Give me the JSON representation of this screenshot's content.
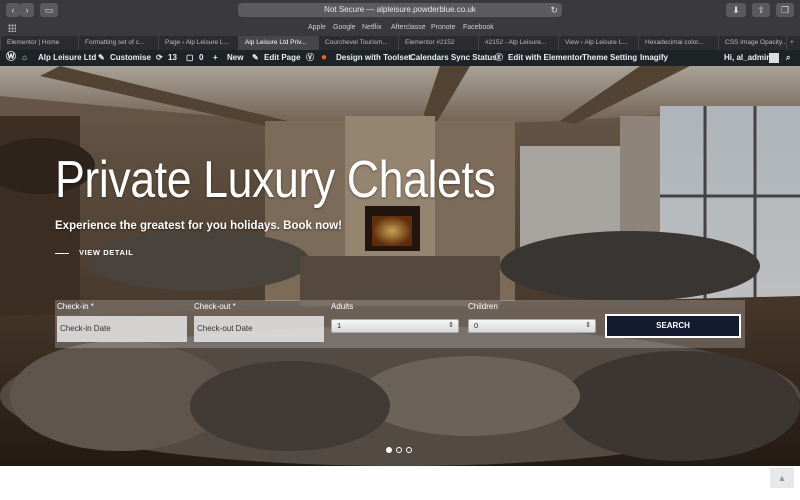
{
  "browser": {
    "url_text": "Not Secure — alpleisure.powderblue.co.uk",
    "favorites": [
      "Apple",
      "Google",
      "Netflix",
      "Afterclasse",
      "Pronote",
      "Facebook"
    ],
    "tabs": [
      "Elementor | Home",
      "Formatting set of c...",
      "Page ‹ Alp Leisure L...",
      "Alp Leisure Ltd Priv...",
      "Courchevel Tourism...",
      "Elementor #2152",
      "#2152 - Alp Leisure...",
      "View ‹ Alp Leisure L...",
      "Hexadecimal color...",
      "CSS Image Opacity..."
    ],
    "active_tab_index": 3,
    "new_tab": "+"
  },
  "wpbar": {
    "site_name": "Alp Leisure Ltd",
    "customise": "Customise",
    "updates": "13",
    "comments": "0",
    "new": "New",
    "edit_page": "Edit Page",
    "design_toolset": "Design with Toolset",
    "calendars": "Calendars Sync Status",
    "elementor": "Edit with Elementor",
    "theme_setting": "Theme Setting",
    "imagify": "Imagify",
    "greeting": "Hi, al_admin"
  },
  "hero": {
    "headline": "Private Luxury Chalets",
    "subline": "Experience the greatest for you holidays. Book now!",
    "view_detail": "VIEW DETAIL",
    "slides_total": 3,
    "active_slide": 1
  },
  "booking": {
    "checkin_label": "Check-in *",
    "checkin_placeholder": "Check-in Date",
    "checkout_label": "Check-out *",
    "checkout_placeholder": "Check-out Date",
    "adults_label": "Adults",
    "adults_value": "1",
    "children_label": "Children",
    "children_value": "0",
    "search_label": "SEARCH"
  },
  "colors": {
    "search_button": "#141a30",
    "wp_admin_bar": "#1d2327"
  }
}
